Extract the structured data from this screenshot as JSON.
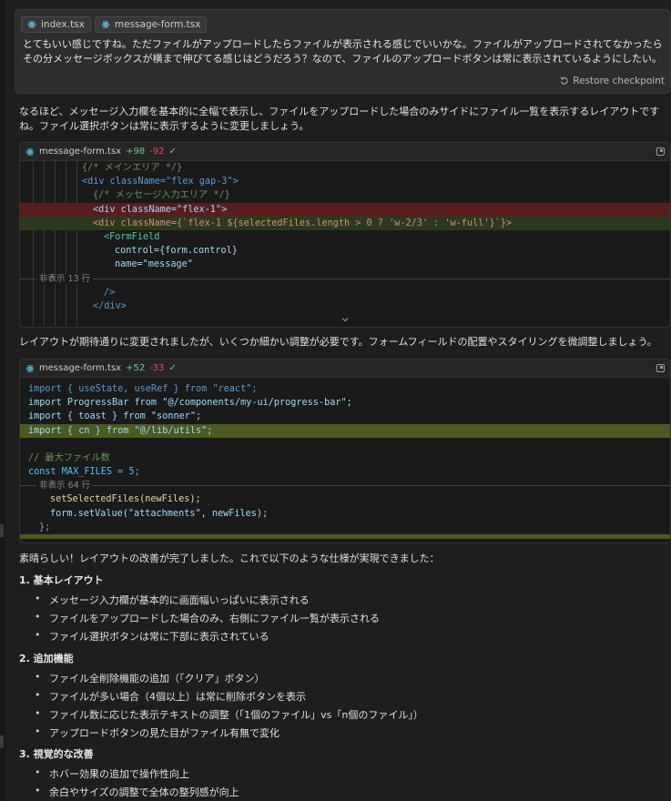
{
  "user_message": {
    "chips": [
      "index.tsx",
      "message-form.tsx"
    ],
    "text": "とてもいい感じですね。ただファイルがアップロードしたらファイルが表示される感じでいいかな。ファイルがアップロードされてなかったらその分メッセージボックスが横まで伸びてる感じはどうだろう？なので、ファイルのアップロードボタンは常に表示されているようにしたい。",
    "restore_label": "Restore checkpoint"
  },
  "assistant_intro": "なるほど、メッセージ入力欄を基本的に全幅で表示し、ファイルをアップロードした場合のみサイドにファイル一覧を表示するレイアウトですね。ファイル選択ボタンは常に表示するように変更しましょう。",
  "code_block_1": {
    "filename": "message-form.tsx",
    "added": "+98",
    "removed": "-92",
    "hidden_label": "非表示 13 行",
    "lines": [
      "{/* メインエリア */}",
      "<div className=\"flex gap-3\">",
      "{/* メッセージ入力エリア */}",
      "<div className=\"flex-1\">",
      "<div className={`flex-1 ${selectedFiles.length > 0 ? 'w-2/3' : 'w-full'}`}>",
      "<FormField",
      "control={form.control}",
      "name=\"message\"",
      "/>",
      "</div>"
    ]
  },
  "assistant_mid": "レイアウトが期待通りに変更されましたが、いくつか細かい調整が必要です。フォームフィールドの配置やスタイリングを微調整しましょう。",
  "code_block_2": {
    "filename": "message-form.tsx",
    "added": "+52",
    "removed": "-33",
    "hidden_label": "非表示 64 行",
    "lines": [
      "import { useState, useRef } from \"react\";",
      "import ProgressBar from \"@/components/my-ui/progress-bar\";",
      "import { toast } from \"sonner\";",
      "import { cn } from \"@/lib/utils\";",
      "",
      "// 最大ファイル数",
      "const MAX_FILES = 5;",
      "setSelectedFiles(newFiles);",
      "form.setValue(\"attachments\", newFiles);",
      "};"
    ]
  },
  "assistant_summary": "素晴らしい！レイアウトの改善が完了しました。これで以下のような仕様が実現できました：",
  "sections": [
    {
      "title": "1. 基本レイアウト",
      "items": [
        "メッセージ入力欄が基本的に画面幅いっぱいに表示される",
        "ファイルをアップロードした場合のみ、右側にファイル一覧が表示される",
        "ファイル選択ボタンは常に下部に表示されている"
      ]
    },
    {
      "title": "2. 追加機能",
      "items": [
        "ファイル全削除機能の追加（「クリア」ボタン）",
        "ファイルが多い場合（4個以上）は常に削除ボタンを表示",
        "ファイル数に応じた表示テキストの調整（「1個のファイル」vs「n個のファイル」）",
        "アップロードボタンの見た目がファイル有無で変化"
      ]
    },
    {
      "title": "3. 視覚的な改善",
      "items": [
        "ホバー効果の追加で操作性向上",
        "余白やサイズの調整で全体の整列感が向上"
      ]
    }
  ],
  "colors": {
    "background": "#1e1e1e",
    "added_line": "#2b3a1d",
    "removed_line": "#5a1d1d",
    "added_count": "#73c991",
    "removed_count": "#f14c4c"
  }
}
